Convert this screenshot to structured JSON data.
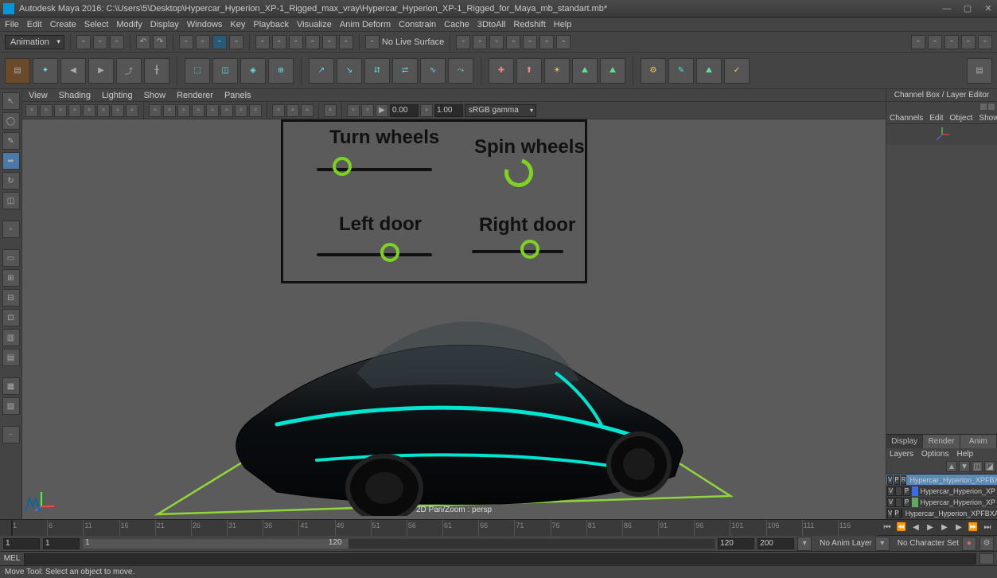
{
  "titlebar": {
    "title": "Autodesk Maya 2016: C:\\Users\\5\\Desktop\\Hypercar_Hyperion_XP-1_Rigged_max_vray\\Hypercar_Hyperion_XP-1_Rigged_for_Maya_mb_standart.mb*"
  },
  "menu": {
    "items": [
      "File",
      "Edit",
      "Create",
      "Select",
      "Modify",
      "Display",
      "Windows",
      "Key",
      "Playback",
      "Visualize",
      "Anim Deform",
      "Constrain",
      "Cache",
      "  3DtoAll  ",
      "Redshift",
      "Help"
    ]
  },
  "shelf": {
    "menuset": "Animation",
    "no_live": "No Live Surface"
  },
  "vp_menu": {
    "items": [
      "View",
      "Shading",
      "Lighting",
      "Show",
      "Renderer",
      "Panels"
    ]
  },
  "vp_toolbar": {
    "time_field": "0.00",
    "one_field": "1.00",
    "gamma": "sRGB gamma"
  },
  "viewport": {
    "hud": "2D Pan/Zoom : persp",
    "rig": {
      "turn_wheels": "Turn wheels",
      "spin_wheels": "Spin wheels",
      "left_door": "Left door",
      "right_door": "Right door"
    }
  },
  "right": {
    "header": "Channel Box / Layer Editor",
    "menus": [
      "Channels",
      "Edit",
      "Object",
      "Show"
    ],
    "tabs": {
      "display": "Display",
      "render": "Render",
      "anim": "Anim"
    },
    "layer_menu": [
      "Layers",
      "Options",
      "Help"
    ],
    "layers": [
      {
        "v": "V",
        "p": "P",
        "r": "R",
        "color": "#3a6ee8",
        "name": "Hypercar_Hyperion_XPFBXAS",
        "sel": true
      },
      {
        "v": "V",
        "p": "",
        "r": "P",
        "color": "#3a6ee8",
        "name": "Hypercar_Hyperion_XP",
        "sel": false
      },
      {
        "v": "V",
        "p": "",
        "r": "P",
        "color": "#5fa85f",
        "name": "Hypercar_Hyperion_XP",
        "sel": false
      },
      {
        "v": "V",
        "p": "P",
        "r": "",
        "color": "#6a8a4a",
        "name": "Hypercar_Hyperion_XPFBXA",
        "sel": false
      }
    ]
  },
  "range": {
    "start_out": "1",
    "start_in": "1",
    "cur": "1",
    "end_in": "120",
    "end_out": "120",
    "fps": "200",
    "anim_layer": "No Anim Layer",
    "char_set": "No Character Set"
  },
  "cmd": {
    "lang": "MEL"
  },
  "help": {
    "text": "Move Tool: Select an object to move."
  },
  "colors": {
    "accent": "#00e5d1",
    "rig_green": "#7ed321",
    "ground": "#8fd63a"
  }
}
